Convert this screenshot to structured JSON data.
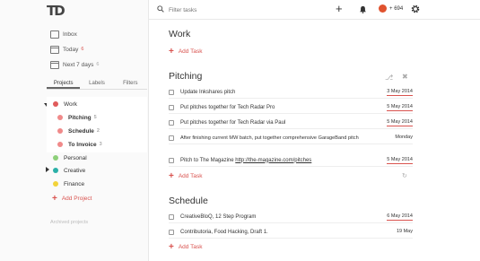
{
  "logo": "TD",
  "sidebar": {
    "filters": [
      {
        "label": "Inbox",
        "count": "",
        "icon": "inbox-icon"
      },
      {
        "label": "Today",
        "count": "6",
        "icon": "calendar-today-icon"
      },
      {
        "label": "Next 7 days",
        "count": "6",
        "icon": "calendar-week-icon"
      }
    ],
    "tabs": [
      "Projects",
      "Labels",
      "Filters"
    ],
    "projects": [
      {
        "label": "Work",
        "count": "",
        "color": "#e05b5b"
      },
      {
        "label": "Pitching",
        "count": "5",
        "color": "#f08a8a"
      },
      {
        "label": "Schedule",
        "count": "2",
        "color": "#f08a8a"
      },
      {
        "label": "To Invoice",
        "count": "3",
        "color": "#f08a8a"
      },
      {
        "label": "Personal",
        "count": "",
        "color": "#8ed07a"
      },
      {
        "label": "Creative",
        "count": "",
        "color": "#2bb0a8"
      },
      {
        "label": "Finance",
        "count": "",
        "color": "#f2d33a"
      }
    ],
    "add_project": "Add Project",
    "archived": "Archived projects"
  },
  "topbar": {
    "search_placeholder": "Filter tasks",
    "karma": "694",
    "karma_sign": "+"
  },
  "sections": {
    "work": {
      "title": "Work",
      "add_task": "Add Task"
    },
    "pitching": {
      "title": "Pitching",
      "add_task": "Add Task",
      "tasks": [
        {
          "text": "Update Inkshares pitch",
          "date": "3 May 2014"
        },
        {
          "text": "Put pitches together for Tech Radar Pro",
          "date": "5 May 2014"
        },
        {
          "text": "Put pitches together for Tech Radar via Paul",
          "date": "5 May 2014"
        },
        {
          "text": "After finishing current MW batch, put together comprehensive GarageBand pitch",
          "date": "Monday"
        },
        {
          "text": "Pitch to The Magazine ",
          "link": "http://the-magazine.com/pitches",
          "date": "5 May 2014"
        }
      ]
    },
    "schedule": {
      "title": "Schedule",
      "add_task": "Add Task",
      "tasks": [
        {
          "text": "CreativeBloQ, 12 Step Program",
          "date": "6 May 2014"
        },
        {
          "text": "Contributoria, Food Hacking, Draft 1.",
          "date": "19 May"
        }
      ]
    }
  },
  "colors": {
    "accent": "#d9534f",
    "karma": "#e0522e"
  }
}
